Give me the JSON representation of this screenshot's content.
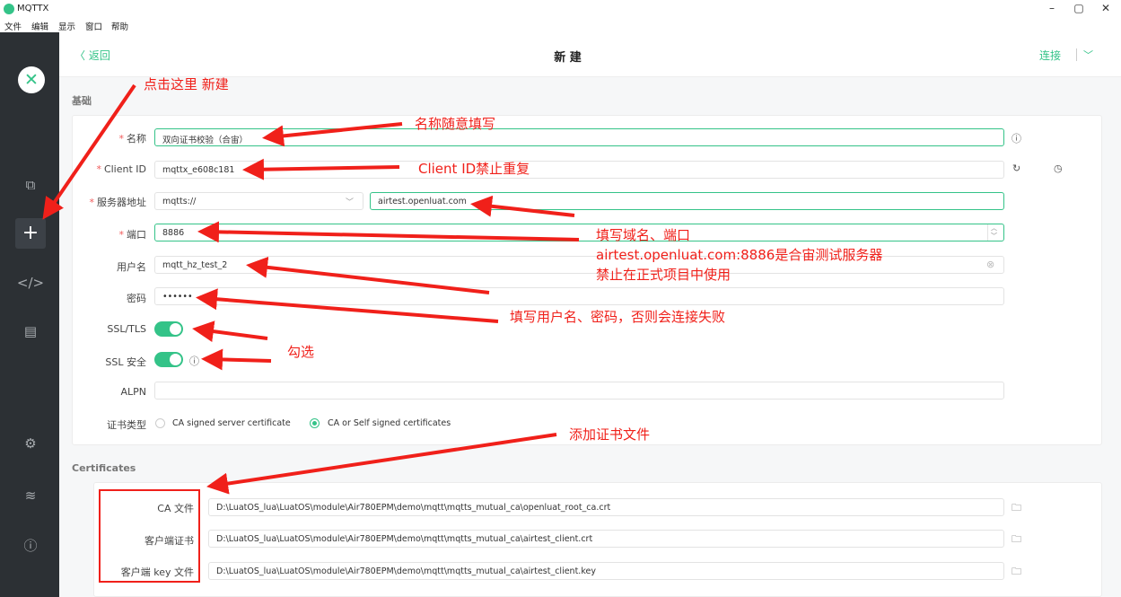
{
  "window": {
    "title": "MQTTX",
    "controls": {
      "minimize": "–",
      "maximize": "▢",
      "close": "✕"
    }
  },
  "menu": [
    "文件",
    "编辑",
    "显示",
    "窗口",
    "帮助"
  ],
  "sidebar": {
    "logo": "✕",
    "icons": [
      "copy-icon",
      "plus-icon",
      "code-icon",
      "log-icon",
      "gear-icon",
      "rss-icon",
      "info-icon"
    ]
  },
  "header": {
    "back": "〈 返回",
    "title": "新 建",
    "connect": "连接",
    "connect_chevron": "﹀"
  },
  "basic": {
    "section_title": "基础",
    "required_mark": "*",
    "name": {
      "label": "名称",
      "value": "双向证书校验（合宙）"
    },
    "client_id": {
      "label": "Client ID",
      "value": "mqttx_e608c181"
    },
    "server": {
      "label": "服务器地址",
      "protocol": "mqtts://",
      "host": "airtest.openluat.com"
    },
    "port": {
      "label": "端口",
      "value": "8886"
    },
    "username": {
      "label": "用户名",
      "value": "mqtt_hz_test_2"
    },
    "password": {
      "label": "密码",
      "value": "••••••"
    },
    "ssl_tls": {
      "label": "SSL/TLS",
      "on": true
    },
    "ssl_secure": {
      "label": "SSL 安全",
      "on": true
    },
    "alpn": {
      "label": "ALPN",
      "value": ""
    },
    "cert_type": {
      "label": "证书类型",
      "options": [
        "CA signed server certificate",
        "CA or Self signed certificates"
      ],
      "selected": 1
    }
  },
  "certificates": {
    "section_title": "Certificates",
    "ca": {
      "label": "CA 文件",
      "value": "D:\\LuatOS_lua\\LuatOS\\module\\Air780EPM\\demo\\mqtt\\mqtts_mutual_ca\\openluat_root_ca.crt"
    },
    "client_cert": {
      "label": "客户端证书",
      "value": "D:\\LuatOS_lua\\LuatOS\\module\\Air780EPM\\demo\\mqtt\\mqtts_mutual_ca\\airtest_client.crt"
    },
    "client_key": {
      "label": "客户端 key 文件",
      "value": "D:\\LuatOS_lua\\LuatOS\\module\\Air780EPM\\demo\\mqtt\\mqtts_mutual_ca\\airtest_client.key"
    }
  },
  "annotations": {
    "new": "点击这里 新建",
    "name": "名称随意填写",
    "client_id": "Client ID禁止重复",
    "domain_port": "填写域名、端口",
    "server_info": "airtest.openluat.com:8886是合宙测试服务器",
    "no_production": "禁止在正式项目中使用",
    "credentials": "填写用户名、密码，否则会连接失败",
    "check": "勾选",
    "add_cert": "添加证书文件"
  },
  "colors": {
    "accent": "#34c388",
    "sidebar": "#2c3034",
    "annotation": "#f0201a"
  }
}
